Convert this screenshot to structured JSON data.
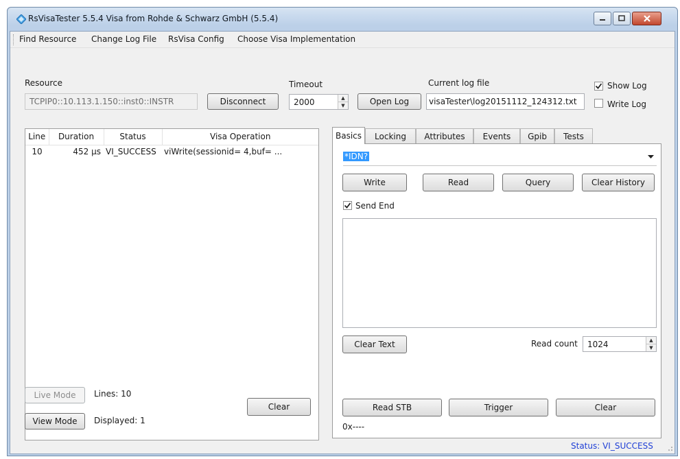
{
  "window": {
    "title": "RsVisaTester 5.5.4 Visa from Rohde & Schwarz GmbH (5.5.4)",
    "icon": "app-diamond-icon",
    "controls": [
      "minimize-icon",
      "maximize-icon",
      "close-icon"
    ]
  },
  "menu": [
    "Find Resource",
    "Change Log File",
    "RsVisa Config",
    "Choose Visa Implementation"
  ],
  "top": {
    "resource_label": "Resource",
    "resource_value": "TCPIP0::10.113.1.150::inst0::INSTR",
    "disconnect_label": "Disconnect",
    "timeout_label": "Timeout",
    "timeout_value": "2000",
    "open_log_label": "Open Log",
    "current_log_label": "Current log file",
    "current_log_value": "visaTester\\log20151112_124312.txt",
    "show_log": {
      "label": "Show Log",
      "checked": true
    },
    "write_log": {
      "label": "Write Log",
      "checked": false
    }
  },
  "log_table": {
    "columns": [
      "Line",
      "Duration",
      "Status",
      "Visa Operation"
    ],
    "rows": [
      {
        "line": "10",
        "duration": "452 µs",
        "status": "VI_SUCCESS",
        "operation": "viWrite(sessionid= 4,buf= ..."
      }
    ]
  },
  "left_bottom": {
    "live_mode_label": "Live Mode",
    "view_mode_label": "View Mode",
    "lines_text": "Lines:  10",
    "displayed_text": "Displayed:  1",
    "clear_label": "Clear"
  },
  "tabs": [
    {
      "label": "Basics",
      "active": true
    },
    {
      "label": "Locking",
      "active": false
    },
    {
      "label": "Attributes",
      "active": false
    },
    {
      "label": "Events",
      "active": false
    },
    {
      "label": "Gpib",
      "active": false
    },
    {
      "label": "Tests",
      "active": false
    }
  ],
  "basics": {
    "command_value": "*IDN?",
    "write_label": "Write",
    "read_label": "Read",
    "query_label": "Query",
    "clear_history_label": "Clear History",
    "send_end": {
      "label": "Send End",
      "checked": true
    },
    "response_text": "",
    "clear_text_label": "Clear Text",
    "read_count_label": "Read count",
    "read_count_value": "1024",
    "read_stb_label": "Read STB",
    "trigger_label": "Trigger",
    "clear_label": "Clear",
    "stb_value": "0x----"
  },
  "status_bar": {
    "text": "Status: VI_SUCCESS",
    "color": "#1f3fd6"
  },
  "colors": {
    "selection": "#3399ff",
    "title_gradient_top": "#d7e4f2",
    "close_button": "#c2482e"
  }
}
